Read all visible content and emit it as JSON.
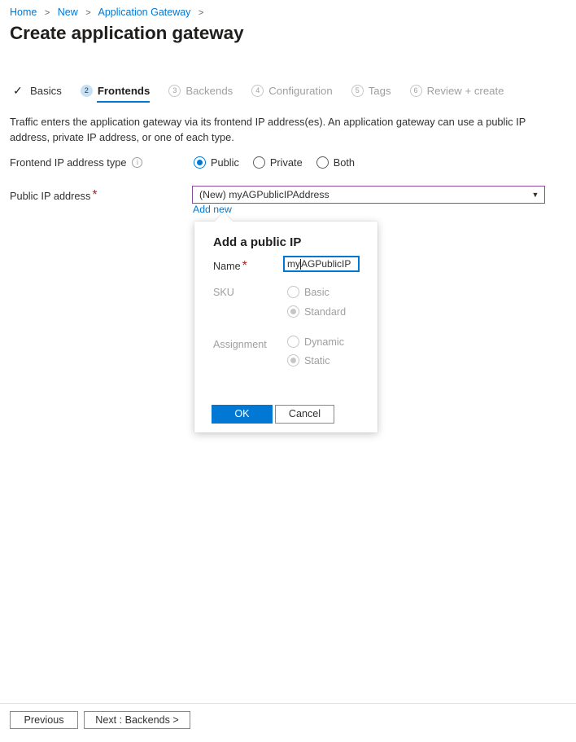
{
  "breadcrumb": {
    "items": [
      "Home",
      "New",
      "Application Gateway"
    ],
    "separator": ">"
  },
  "page_title": "Create application gateway",
  "wizard_tabs": [
    {
      "label": "Basics",
      "marker": "✓",
      "state": "done"
    },
    {
      "label": "Frontends",
      "marker": "2",
      "state": "active"
    },
    {
      "label": "Backends",
      "marker": "3",
      "state": "future"
    },
    {
      "label": "Configuration",
      "marker": "4",
      "state": "future"
    },
    {
      "label": "Tags",
      "marker": "5",
      "state": "future"
    },
    {
      "label": "Review + create",
      "marker": "6",
      "state": "future"
    }
  ],
  "description": "Traffic enters the application gateway via its frontend IP address(es). An application gateway can use a public IP address, private IP address, or one of each type.",
  "form": {
    "frontend_type": {
      "label": "Frontend IP address type",
      "info_icon": "info-icon",
      "options": [
        "Public",
        "Private",
        "Both"
      ],
      "selected": "Public"
    },
    "public_ip": {
      "label": "Public IP address",
      "required_marker": "*",
      "selected_value": "(New) myAGPublicIPAddress",
      "chevron_icon": "chevron-down-icon",
      "add_new_label": "Add new"
    }
  },
  "dialog": {
    "title": "Add a public IP",
    "name": {
      "label": "Name",
      "required_marker": "*",
      "value_before_caret": "my",
      "value_after_caret": "AGPublicIP",
      "full_value": "myAGPublicIPAddress"
    },
    "sku": {
      "label": "SKU",
      "options": [
        "Basic",
        "Standard"
      ],
      "selected": "Standard",
      "disabled": true
    },
    "assignment": {
      "label": "Assignment",
      "options": [
        "Dynamic",
        "Static"
      ],
      "selected": "Static",
      "disabled": true
    },
    "ok_label": "OK",
    "cancel_label": "Cancel"
  },
  "footer": {
    "previous_label": "Previous",
    "next_label": "Next : Backends >"
  },
  "colors": {
    "accent": "#0078d4",
    "link": "#0078d4",
    "required": "#a4262c",
    "focus_border": "#8f4aa0",
    "disabled_text": "#a19f9d",
    "tab_badge_bg": "#c7e0f4"
  }
}
